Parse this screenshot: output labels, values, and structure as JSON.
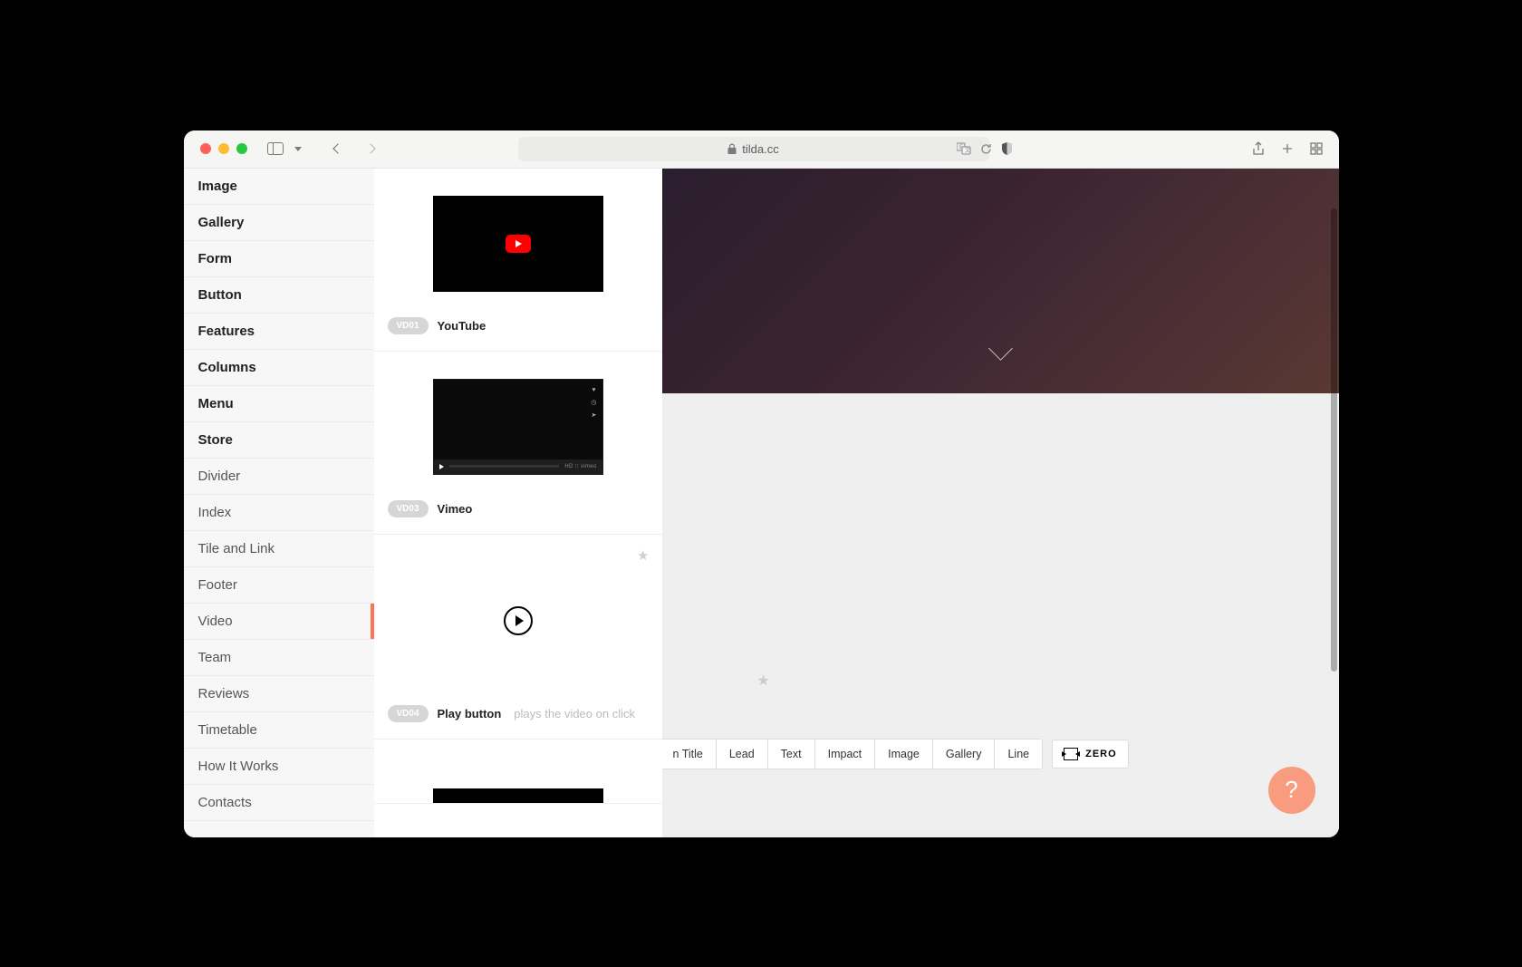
{
  "browser": {
    "url": "tilda.cc"
  },
  "categories": [
    {
      "label": "Image",
      "bold": true
    },
    {
      "label": "Gallery",
      "bold": true
    },
    {
      "label": "Form",
      "bold": true
    },
    {
      "label": "Button",
      "bold": true
    },
    {
      "label": "Features",
      "bold": true
    },
    {
      "label": "Columns",
      "bold": true
    },
    {
      "label": "Menu",
      "bold": true
    },
    {
      "label": "Store",
      "bold": true
    },
    {
      "label": "Divider",
      "bold": false
    },
    {
      "label": "Index",
      "bold": false
    },
    {
      "label": "Tile and Link",
      "bold": false
    },
    {
      "label": "Footer",
      "bold": false
    },
    {
      "label": "Video",
      "bold": false,
      "active": true
    },
    {
      "label": "Team",
      "bold": false
    },
    {
      "label": "Reviews",
      "bold": false
    },
    {
      "label": "Timetable",
      "bold": false
    },
    {
      "label": "How It Works",
      "bold": false
    },
    {
      "label": "Contacts",
      "bold": false
    }
  ],
  "blocks": [
    {
      "code": "VD01",
      "name": "YouTube",
      "desc": "",
      "type": "youtube"
    },
    {
      "code": "VD03",
      "name": "Vimeo",
      "desc": "",
      "type": "vimeo"
    },
    {
      "code": "VD04",
      "name": "Play button",
      "desc": "plays the video on click",
      "type": "play",
      "starred": true
    }
  ],
  "vimeo_label": "HD ⁝⁝ vimeo",
  "quickbar": {
    "items": [
      "n Title",
      "Lead",
      "Text",
      "Impact",
      "Image",
      "Gallery",
      "Line"
    ],
    "zero": "ZERO"
  },
  "help": "?"
}
